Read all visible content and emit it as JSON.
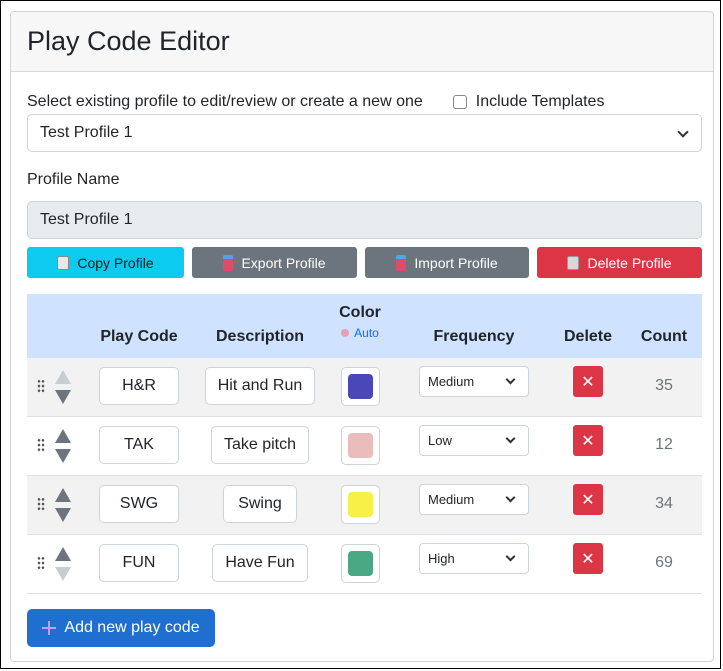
{
  "window_title": "Play Code Editor",
  "profile_select": {
    "label": "Select existing profile to edit/review or create a new one",
    "include_templates_label": "Include Templates",
    "include_templates_checked": false,
    "selected": "Test Profile 1"
  },
  "profile_name": {
    "label": "Profile Name",
    "value": "Test Profile 1"
  },
  "buttons": {
    "copy": "Copy Profile",
    "export": "Export Profile",
    "import": "Import Profile",
    "delete": "Delete Profile"
  },
  "table": {
    "headers": {
      "play_code": "Play Code",
      "description": "Description",
      "color": "Color",
      "color_auto": "Auto",
      "frequency": "Frequency",
      "delete": "Delete",
      "count": "Count"
    },
    "rows": [
      {
        "code": "H&R",
        "description": "Hit and Run",
        "color": "#4a48b8",
        "frequency": "Medium",
        "count": "35"
      },
      {
        "code": "TAK",
        "description": "Take pitch",
        "color": "#ebbcbc",
        "frequency": "Low",
        "count": "12"
      },
      {
        "code": "SWG",
        "description": "Swing",
        "color": "#f7f046",
        "frequency": "Medium",
        "count": "34"
      },
      {
        "code": "FUN",
        "description": "Have Fun",
        "color": "#4aa885",
        "frequency": "High",
        "count": "69"
      }
    ]
  },
  "add_button": "Add new play code",
  "colors": {
    "header_bg": "#cfe2ff",
    "copy_btn": "#0dcaf0",
    "secondary_btn": "#6c757d",
    "danger_btn": "#dc3545",
    "primary_btn": "#1f6fd1"
  }
}
